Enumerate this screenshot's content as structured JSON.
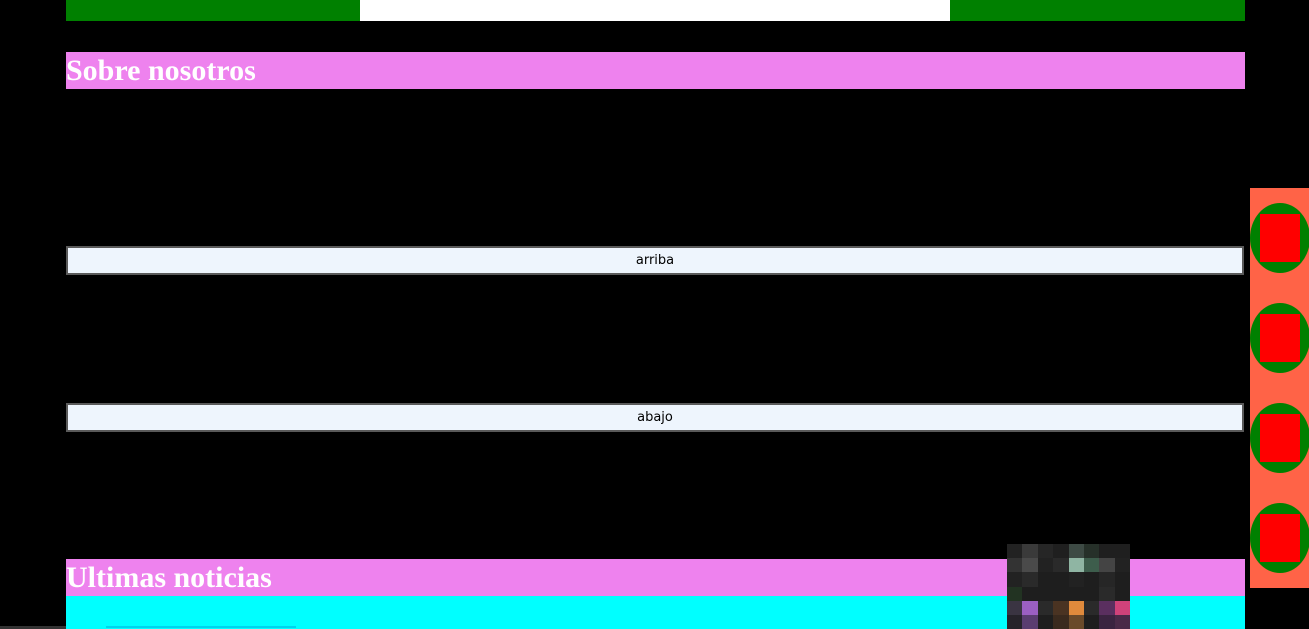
{
  "sections": {
    "about_title": "Sobre nosotros",
    "news_title": "Ultimas noticias"
  },
  "buttons": {
    "up_label": "arriba",
    "down_label": "abajo"
  },
  "side_panel": {
    "items": [
      "social-link-1",
      "social-link-2",
      "social-link-3",
      "social-link-4"
    ]
  },
  "colors": {
    "background": "#000000",
    "header": "#ee82ee",
    "strip_green": "#008000",
    "strip_white": "#ffffff",
    "button_bg": "#eef5fd",
    "cyan": "#00ffff",
    "side_panel": "#ff6347",
    "side_circle": "#008000",
    "side_square": "#ff0000"
  }
}
